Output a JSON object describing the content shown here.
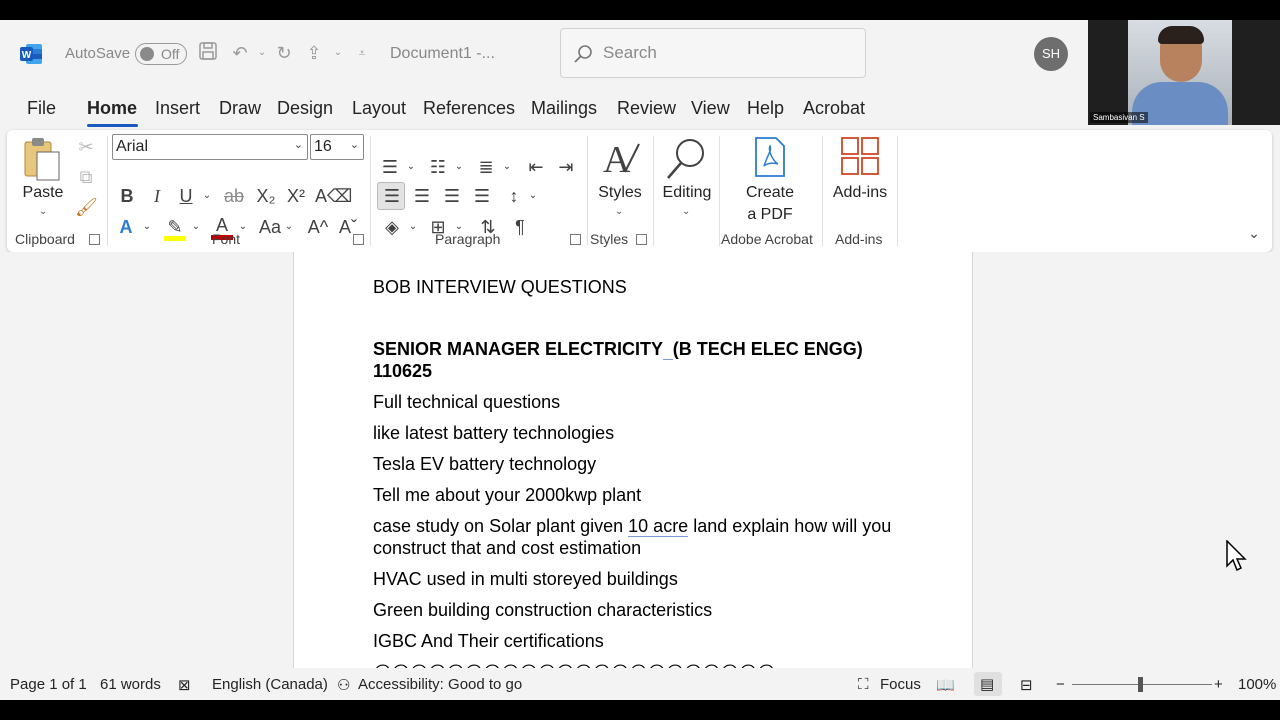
{
  "app": {
    "autosave_label": "AutoSave",
    "autosave_state": "Off",
    "document_title": "Document1  -...",
    "search_placeholder": "Search",
    "user_initials": "SH",
    "video_participant": "Sambasivan S"
  },
  "tabs": [
    "File",
    "Home",
    "Insert",
    "Draw",
    "Design",
    "Layout",
    "References",
    "Mailings",
    "Review",
    "View",
    "Help",
    "Acrobat"
  ],
  "active_tab": "Home",
  "ribbon": {
    "clipboard": {
      "paste_label": "Paste",
      "group_label": "Clipboard"
    },
    "font": {
      "font_name": "Arial",
      "font_size": "16",
      "group_label": "Font",
      "bold": "B",
      "italic": "I",
      "underline": "U",
      "strike": "ab",
      "subscript": "X₂",
      "superscript": "X²",
      "change_case": "Aa",
      "grow": "A^",
      "shrink": "Aˇ"
    },
    "paragraph": {
      "group_label": "Paragraph"
    },
    "styles": {
      "label": "Styles",
      "group_label": "Styles"
    },
    "editing": {
      "label": "Editing"
    },
    "acrobat": {
      "label_line1": "Create",
      "label_line2": "a PDF",
      "group_label": "Adobe Acrobat"
    },
    "addins": {
      "label": "Add-ins",
      "group_label": "Add-ins"
    }
  },
  "document": {
    "line1": "BOB INTERVIEW QUESTIONS",
    "heading_part1": "SENIOR MANAGER ELECTRICITY",
    "heading_gap": "  ",
    "heading_part2": "(B TECH ELEC ENGG)",
    "heading_line2": "110625",
    "q1": "Full technical questions",
    "q2": "like latest battery technologies",
    "q3": "Tesla EV battery technology",
    "q4": "Tell me about your 2000kwp plant",
    "q5_part1": "case study on Solar plant given ",
    "q5_underlined": "10 acre",
    "q5_part2": " land explain how will you",
    "q5_line2": "construct that and cost estimation",
    "q6": "HVAC used in multi storeyed buildings",
    "q7": "Green building construction characteristics",
    "q8": "IGBC And Their certifications",
    "q9": "@@@@@@@@@@@@@@@@@@@@@@"
  },
  "status": {
    "page": "Page 1 of 1",
    "words": "61 words",
    "language": "English (Canada)",
    "accessibility": "Accessibility: Good to go",
    "focus": "Focus",
    "zoom": "100%"
  },
  "colors": {
    "accent": "#185abd",
    "ribbon_bg": "#ffffff",
    "app_bg": "#f3f3f3"
  }
}
